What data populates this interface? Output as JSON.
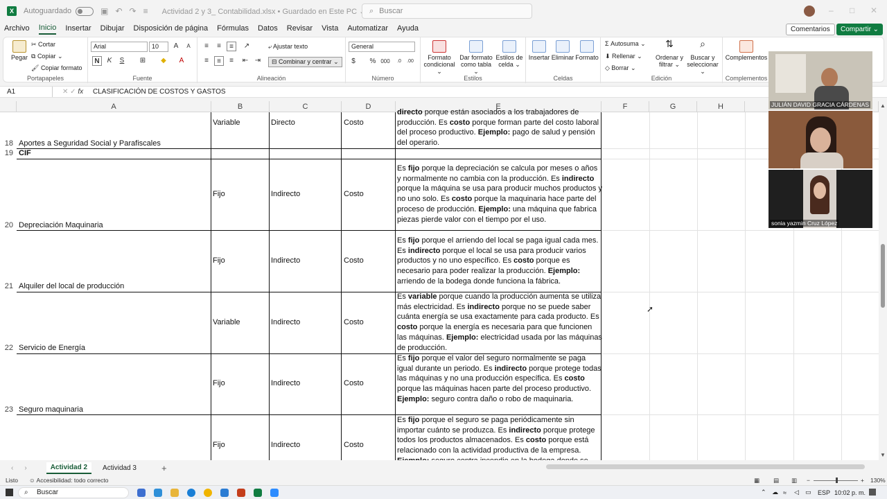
{
  "titlebar": {
    "autosave": "Autoguardado",
    "doc_title": "Actividad 2 y 3_ Contabilidad.xlsx  •  Guardado en Este PC ⌄",
    "search_placeholder": "Buscar"
  },
  "menu": [
    "Archivo",
    "Inicio",
    "Insertar",
    "Dibujar",
    "Disposición de página",
    "Fórmulas",
    "Datos",
    "Revisar",
    "Vista",
    "Automatizar",
    "Ayuda"
  ],
  "menu_active": "Inicio",
  "buttons": {
    "comments": "Comentarios",
    "share": "Compartir ⌄"
  },
  "ribbon": {
    "paste": "Pegar",
    "cut": "Cortar",
    "copy": "Copiar",
    "copy_format": "Copiar formato",
    "clipboard_label": "Portapapeles",
    "font_name": "Arial",
    "font_size": "10",
    "font_label": "Fuente",
    "wrap_text": "Ajustar texto",
    "merge_center": "Combinar y centrar",
    "alignment_label": "Alineación",
    "number_format": "General",
    "number_label": "Número",
    "conditional_format": "Formato condicional ⌄",
    "format_table": "Dar formato como tabla ⌄",
    "cell_styles": "Estilos de celda ⌄",
    "styles_label": "Estilos",
    "insert": "Insertar",
    "delete": "Eliminar",
    "format": "Formato",
    "cells_label": "Celdas",
    "autosum": "Autosuma",
    "fill": "Rellenar",
    "clear": "Borrar",
    "sort_filter": "Ordenar y filtrar ⌄",
    "find_select": "Buscar y seleccionar ⌄",
    "editing_label": "Edición",
    "addins": "Complementos",
    "addins_label": "Complementos"
  },
  "formula_bar": {
    "name_box": "A1",
    "formula": "CLASIFICACIÓN DE COSTOS Y GASTOS"
  },
  "columns": [
    "A",
    "B",
    "C",
    "D",
    "E",
    "F",
    "G",
    "H"
  ],
  "rows": [
    {
      "num": "18",
      "a": "Aportes a Seguridad Social y Parafiscales",
      "b": "Variable",
      "c": "Directo",
      "d": "Costo"
    },
    {
      "num": "19",
      "a": "CIF",
      "b": "",
      "c": "",
      "d": ""
    },
    {
      "num": "20",
      "a": "Depreciación Maquinaria",
      "b": "Fijo",
      "c": "Indirecto",
      "d": "Costo"
    },
    {
      "num": "21",
      "a": "Alquiler del local de producción",
      "b": "Fijo",
      "c": "Indirecto",
      "d": "Costo"
    },
    {
      "num": "22",
      "a": "Servicio de Energía",
      "b": "Variable",
      "c": "Indirecto",
      "d": "Costo"
    },
    {
      "num": "23",
      "a": "Seguro maquinaria",
      "b": "Fijo",
      "c": "Indirecto",
      "d": "Costo"
    },
    {
      "num": "",
      "a": "",
      "b": "Fijo",
      "c": "Indirecto",
      "d": "Costo"
    }
  ],
  "explanations": {
    "r18": [
      [
        "b",
        "directo"
      ],
      [
        "t",
        " porque están asociados a los trabajadores de producción. Es "
      ],
      [
        "b",
        "costo"
      ],
      [
        "t",
        " porque forman parte del costo laboral del proceso productivo. "
      ],
      [
        "b",
        "Ejemplo:"
      ],
      [
        "t",
        " pago de salud y pensión del operario."
      ]
    ],
    "r20": [
      [
        "t",
        "Es "
      ],
      [
        "b",
        "fijo"
      ],
      [
        "t",
        " porque la depreciación se calcula por meses o años y normalmente no cambia con la producción. Es "
      ],
      [
        "b",
        "indirecto"
      ],
      [
        "t",
        " porque la máquina se usa para producir muchos productos y no uno solo. Es "
      ],
      [
        "b",
        "costo"
      ],
      [
        "t",
        " porque la maquinaria hace parte del proceso de producción. "
      ],
      [
        "b",
        "Ejemplo:"
      ],
      [
        "t",
        " una máquina que fabrica piezas pierde valor con el tiempo por el uso."
      ]
    ],
    "r21": [
      [
        "t",
        "Es "
      ],
      [
        "b",
        "fijo"
      ],
      [
        "t",
        " porque el arriendo del local se paga igual cada mes. Es "
      ],
      [
        "b",
        "indirecto"
      ],
      [
        "t",
        " porque el local se usa para producir varios productos y no uno específico. Es "
      ],
      [
        "b",
        "costo"
      ],
      [
        "t",
        " porque es necesario para poder realizar la producción. "
      ],
      [
        "b",
        "Ejemplo:"
      ],
      [
        "t",
        " arriendo de la bodega donde funciona la fábrica."
      ]
    ],
    "r22": [
      [
        "t",
        "Es "
      ],
      [
        "b",
        "variable"
      ],
      [
        "t",
        " porque cuando la producción aumenta se utiliza más electricidad. Es "
      ],
      [
        "b",
        "indirecto"
      ],
      [
        "t",
        " porque no se puede saber cuánta energía se usa exactamente para cada producto. Es "
      ],
      [
        "b",
        "costo"
      ],
      [
        "t",
        " porque la energía es necesaria para que funcionen las máquinas. "
      ],
      [
        "b",
        "Ejemplo:"
      ],
      [
        "t",
        " electricidad usada por las máquinas de producción."
      ]
    ],
    "r23": [
      [
        "t",
        "Es "
      ],
      [
        "b",
        "fijo"
      ],
      [
        "t",
        " porque el valor del seguro normalmente se paga igual durante un periodo. Es "
      ],
      [
        "b",
        "indirecto"
      ],
      [
        "t",
        " porque protege todas las máquinas y no una producción específica. Es "
      ],
      [
        "b",
        "costo"
      ],
      [
        "t",
        " porque las máquinas hacen parte del proceso productivo. "
      ],
      [
        "b",
        "Ejemplo:"
      ],
      [
        "t",
        " seguro contra daño o robo de maquinaria."
      ]
    ],
    "r24": [
      [
        "t",
        "Es "
      ],
      [
        "b",
        "fijo"
      ],
      [
        "t",
        " porque el seguro se paga periódicamente sin importar cuánto se produzca. Es "
      ],
      [
        "b",
        "indirecto"
      ],
      [
        "t",
        " porque protege todos los productos almacenados. Es "
      ],
      [
        "b",
        "costo"
      ],
      [
        "t",
        " porque está relacionado con la actividad productiva de la empresa. "
      ],
      [
        "b",
        "Ejemplo:"
      ],
      [
        "t",
        " seguro contra incendio en la bodega donde se"
      ]
    ]
  },
  "participants": [
    "JULIÁN DAVID GRACIA CÁRDENAS",
    "sonia yazmin Cruz López"
  ],
  "sheet_tabs": [
    "Actividad 2",
    "Actividad 3"
  ],
  "status": {
    "ready": "Listo",
    "accessibility": "Accesibilidad: todo correcto",
    "zoom": "130%"
  },
  "taskbar": {
    "search": "Buscar",
    "lang": "ESP",
    "time": "10:02 p. m."
  },
  "colors": {
    "excel_green": "#107c41",
    "tab_green": "#185c37"
  }
}
